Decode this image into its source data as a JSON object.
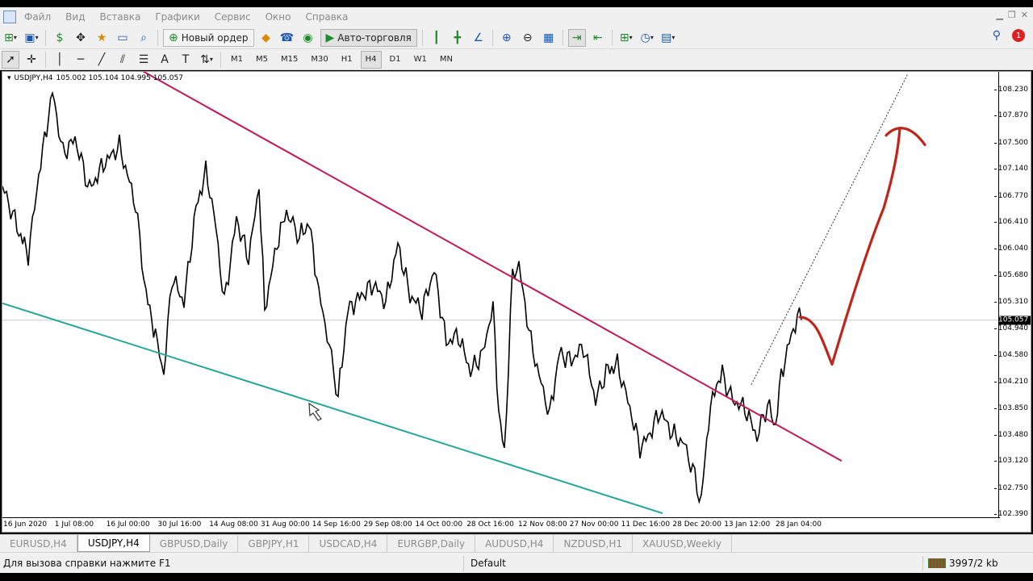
{
  "menu": [
    "Файл",
    "Вид",
    "Вставка",
    "Графики",
    "Сервис",
    "Окно",
    "Справка"
  ],
  "toolbar": {
    "new_order_label": "Новый ордер",
    "autotrading_label": "Авто-торговля",
    "notification_count": "1"
  },
  "timeframes": [
    "M1",
    "M5",
    "M15",
    "M30",
    "H1",
    "H4",
    "D1",
    "W1",
    "MN"
  ],
  "active_timeframe": "H4",
  "chart": {
    "symbol": "USDJPY,H4",
    "ohlc": "105.002 105.104 104.995 105.057",
    "current_price": "105.057",
    "price_ticks": [
      "108.230",
      "107.870",
      "107.500",
      "107.140",
      "106.770",
      "106.410",
      "106.040",
      "105.680",
      "105.310",
      "104.940",
      "104.580",
      "104.210",
      "103.850",
      "103.480",
      "103.120",
      "102.750",
      "102.390"
    ],
    "time_ticks": [
      "16 Jun 2020",
      "1 Jul 08:00",
      "16 Jul 00:00",
      "30 Jul 16:00",
      "14 Aug 08:00",
      "31 Aug 00:00",
      "14 Sep 16:00",
      "29 Sep 08:00",
      "14 Oct 00:00",
      "28 Oct 16:00",
      "12 Nov 08:00",
      "27 Nov 00:00",
      "11 Dec 16:00",
      "28 Dec 20:00",
      "13 Jan 12:00",
      "28 Jan 04:00"
    ],
    "colors": {
      "resistance": "#c2185b",
      "support": "#26a69a",
      "drawing": "#c0241b"
    }
  },
  "tabs": [
    "EURUSD,H4",
    "USDJPY,H4",
    "GBPUSD,Daily",
    "GBPJPY,H1",
    "USDCAD,H4",
    "EURGBP,Daily",
    "AUDUSD,H4",
    "NZDUSD,H1",
    "XAUUSD,Weekly"
  ],
  "active_tab": "USDJPY,H4",
  "status": {
    "help": "Для вызова справки нажмите F1",
    "profile": "Default",
    "traffic": "3997/2 kb"
  }
}
